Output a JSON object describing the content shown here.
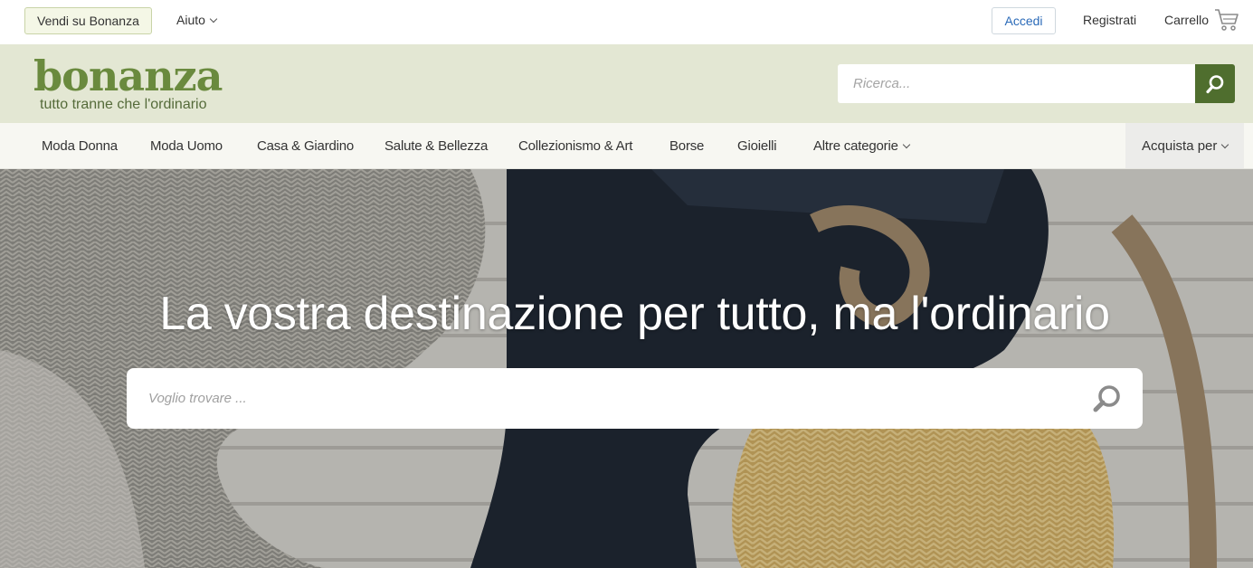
{
  "topbar": {
    "sell_label": "Vendi su Bonanza",
    "help_label": "Aiuto",
    "login_label": "Accedi",
    "register_label": "Registrati",
    "cart_label": "Carrello"
  },
  "brand": {
    "logo": "bonanza",
    "tagline": "tutto tranne che l'ordinario"
  },
  "search": {
    "placeholder": "Ricerca..."
  },
  "nav": {
    "items": [
      {
        "label": "Moda Donna"
      },
      {
        "label": "Moda Uomo"
      },
      {
        "label": "Casa & Giardino"
      },
      {
        "label": "Salute & Bellezza"
      },
      {
        "label": "Collezionismo & Art"
      },
      {
        "label": "Borse"
      },
      {
        "label": "Gioielli"
      },
      {
        "label": "Altre categorie"
      }
    ],
    "shop_by_label": "Acquista per"
  },
  "hero": {
    "title": "La vostra destinazione per tutto, ma l'ordinario",
    "search_placeholder": "Voglio trovare ..."
  },
  "colors": {
    "brand_green": "#6a8a3e",
    "search_button": "#4f6e2e",
    "brand_band": "#e3e7d3",
    "link_blue": "#2a6ab8"
  },
  "icons": {
    "cart": "cart-icon",
    "search": "search-icon",
    "chevron": "chevron-down-icon"
  }
}
